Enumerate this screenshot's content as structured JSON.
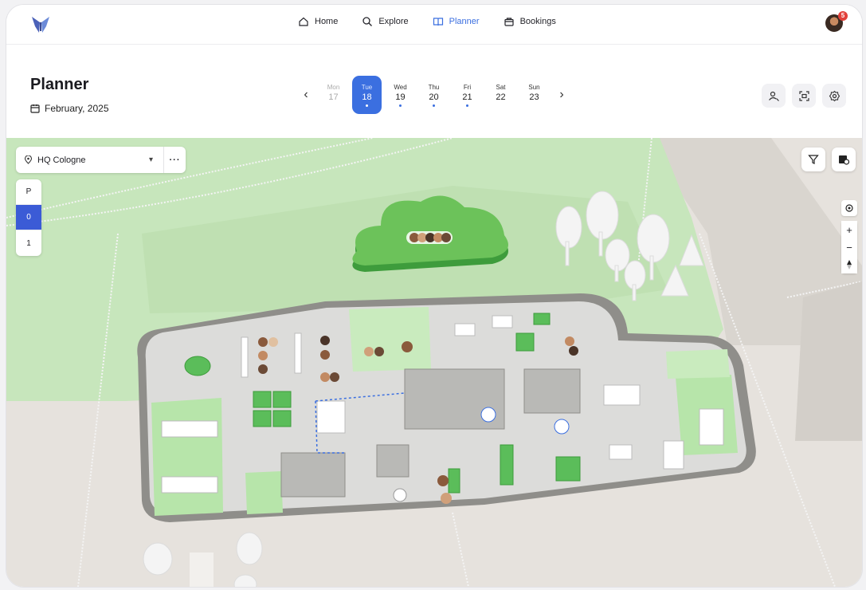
{
  "nav": {
    "items": [
      {
        "label": "Home",
        "icon": "home-icon"
      },
      {
        "label": "Explore",
        "icon": "search-icon"
      },
      {
        "label": "Planner",
        "icon": "book-icon",
        "active": true
      },
      {
        "label": "Bookings",
        "icon": "bag-icon"
      }
    ]
  },
  "user": {
    "notification_count": "5"
  },
  "header": {
    "title": "Planner",
    "month": "February, 2025"
  },
  "days": [
    {
      "name": "Mon",
      "num": "17",
      "state": "past",
      "dot": false
    },
    {
      "name": "Tue",
      "num": "18",
      "state": "selected",
      "dot": true
    },
    {
      "name": "Wed",
      "num": "19",
      "state": "normal",
      "dot": true
    },
    {
      "name": "Thu",
      "num": "20",
      "state": "normal",
      "dot": true
    },
    {
      "name": "Fri",
      "num": "21",
      "state": "normal",
      "dot": true
    },
    {
      "name": "Sat",
      "num": "22",
      "state": "normal",
      "dot": false
    },
    {
      "name": "Sun",
      "num": "23",
      "state": "normal",
      "dot": false
    }
  ],
  "map": {
    "location": "HQ Cologne",
    "more_label": "···",
    "floors": [
      {
        "label": "P",
        "active": false
      },
      {
        "label": "0",
        "active": true
      },
      {
        "label": "1",
        "active": false
      }
    ]
  },
  "colors": {
    "accent": "#3b6fe0",
    "floor_active": "#3b5bd6",
    "desk_green": "#5bbd5a",
    "park_green": "#c8e8c0"
  }
}
